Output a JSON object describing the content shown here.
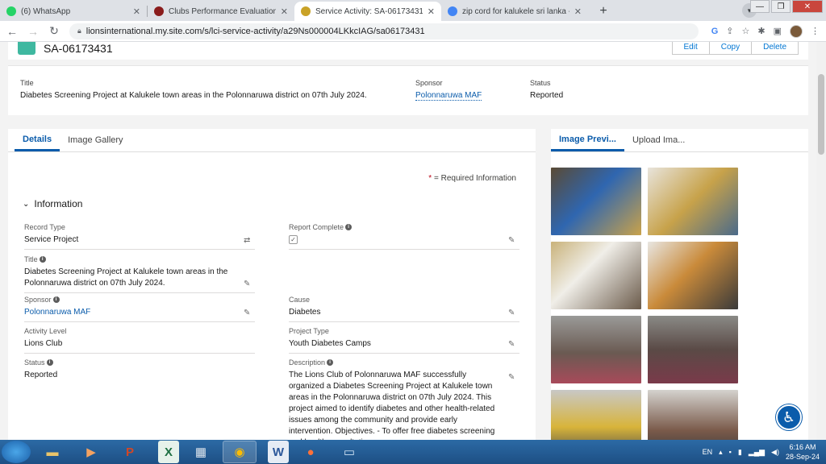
{
  "browser": {
    "tabs": [
      {
        "label": "(6) WhatsApp",
        "icon": "whatsapp-icon",
        "color": "#25d366",
        "active": false
      },
      {
        "label": "Clubs Performance Evaluation Sy",
        "icon": "lions-icon",
        "color": "#8a1c1c",
        "active": false
      },
      {
        "label": "Service Activity: SA-06173431",
        "icon": "lions-icon",
        "color": "#c9a227",
        "active": true
      },
      {
        "label": "zip cord for kalukele sri lanka - G",
        "icon": "google-icon",
        "color": "#4285f4",
        "active": false
      }
    ],
    "url": "lionsinternational.my.site.com/s/lci-service-activity/a29Ns000004LKkcIAG/sa06173431"
  },
  "record": {
    "number": "SA-06173431",
    "buttons": [
      "Edit",
      "Copy",
      "Delete"
    ]
  },
  "highlights": {
    "title_label": "Title",
    "title_value": "Diabetes Screening Project at Kalukele town areas in the Polonnaruwa district on 07th July 2024.",
    "sponsor_label": "Sponsor",
    "sponsor_value": "Polonnaruwa MAF",
    "status_label": "Status",
    "status_value": "Reported"
  },
  "main": {
    "tabs": [
      "Details",
      "Image Gallery"
    ],
    "required_note": "= Required Information",
    "section_title": "Information",
    "fields": {
      "record_type_label": "Record Type",
      "record_type_value": "Service Project",
      "report_complete_label": "Report Complete",
      "title_label": "Title",
      "title_value": "Diabetes Screening Project at Kalukele town areas in the Polonnaruwa district on 07th July 2024.",
      "sponsor_label": "Sponsor",
      "sponsor_value": "Polonnaruwa MAF",
      "cause_label": "Cause",
      "cause_value": "Diabetes",
      "activity_level_label": "Activity Level",
      "activity_level_value": "Lions Club",
      "project_type_label": "Project Type",
      "project_type_value": "Youth Diabetes Camps",
      "status_label": "Status",
      "status_value": "Reported",
      "description_label": "Description",
      "description_value": "The Lions Club of Polonnaruwa MAF successfully organized a Diabetes Screening Project at Kalukele town areas in the Polonnaruwa district on 07th July 2024. This project aimed to identify diabetes and other health-related issues among the community and provide early intervention. Objectives. - To offer free diabetes screening and health consultations."
    }
  },
  "side": {
    "tabs": [
      "Image Previ...",
      "Upload Ima..."
    ],
    "thumbs": [
      "#6a5a3c",
      "#b89a6a",
      "#8c7a64",
      "#a0826a",
      "#6e6a66",
      "#5e5a56",
      "#8a8a8a",
      "#7a7470"
    ]
  },
  "taskbar": {
    "lang": "EN",
    "time": "6:16 AM",
    "date": "28-Sep-24"
  }
}
